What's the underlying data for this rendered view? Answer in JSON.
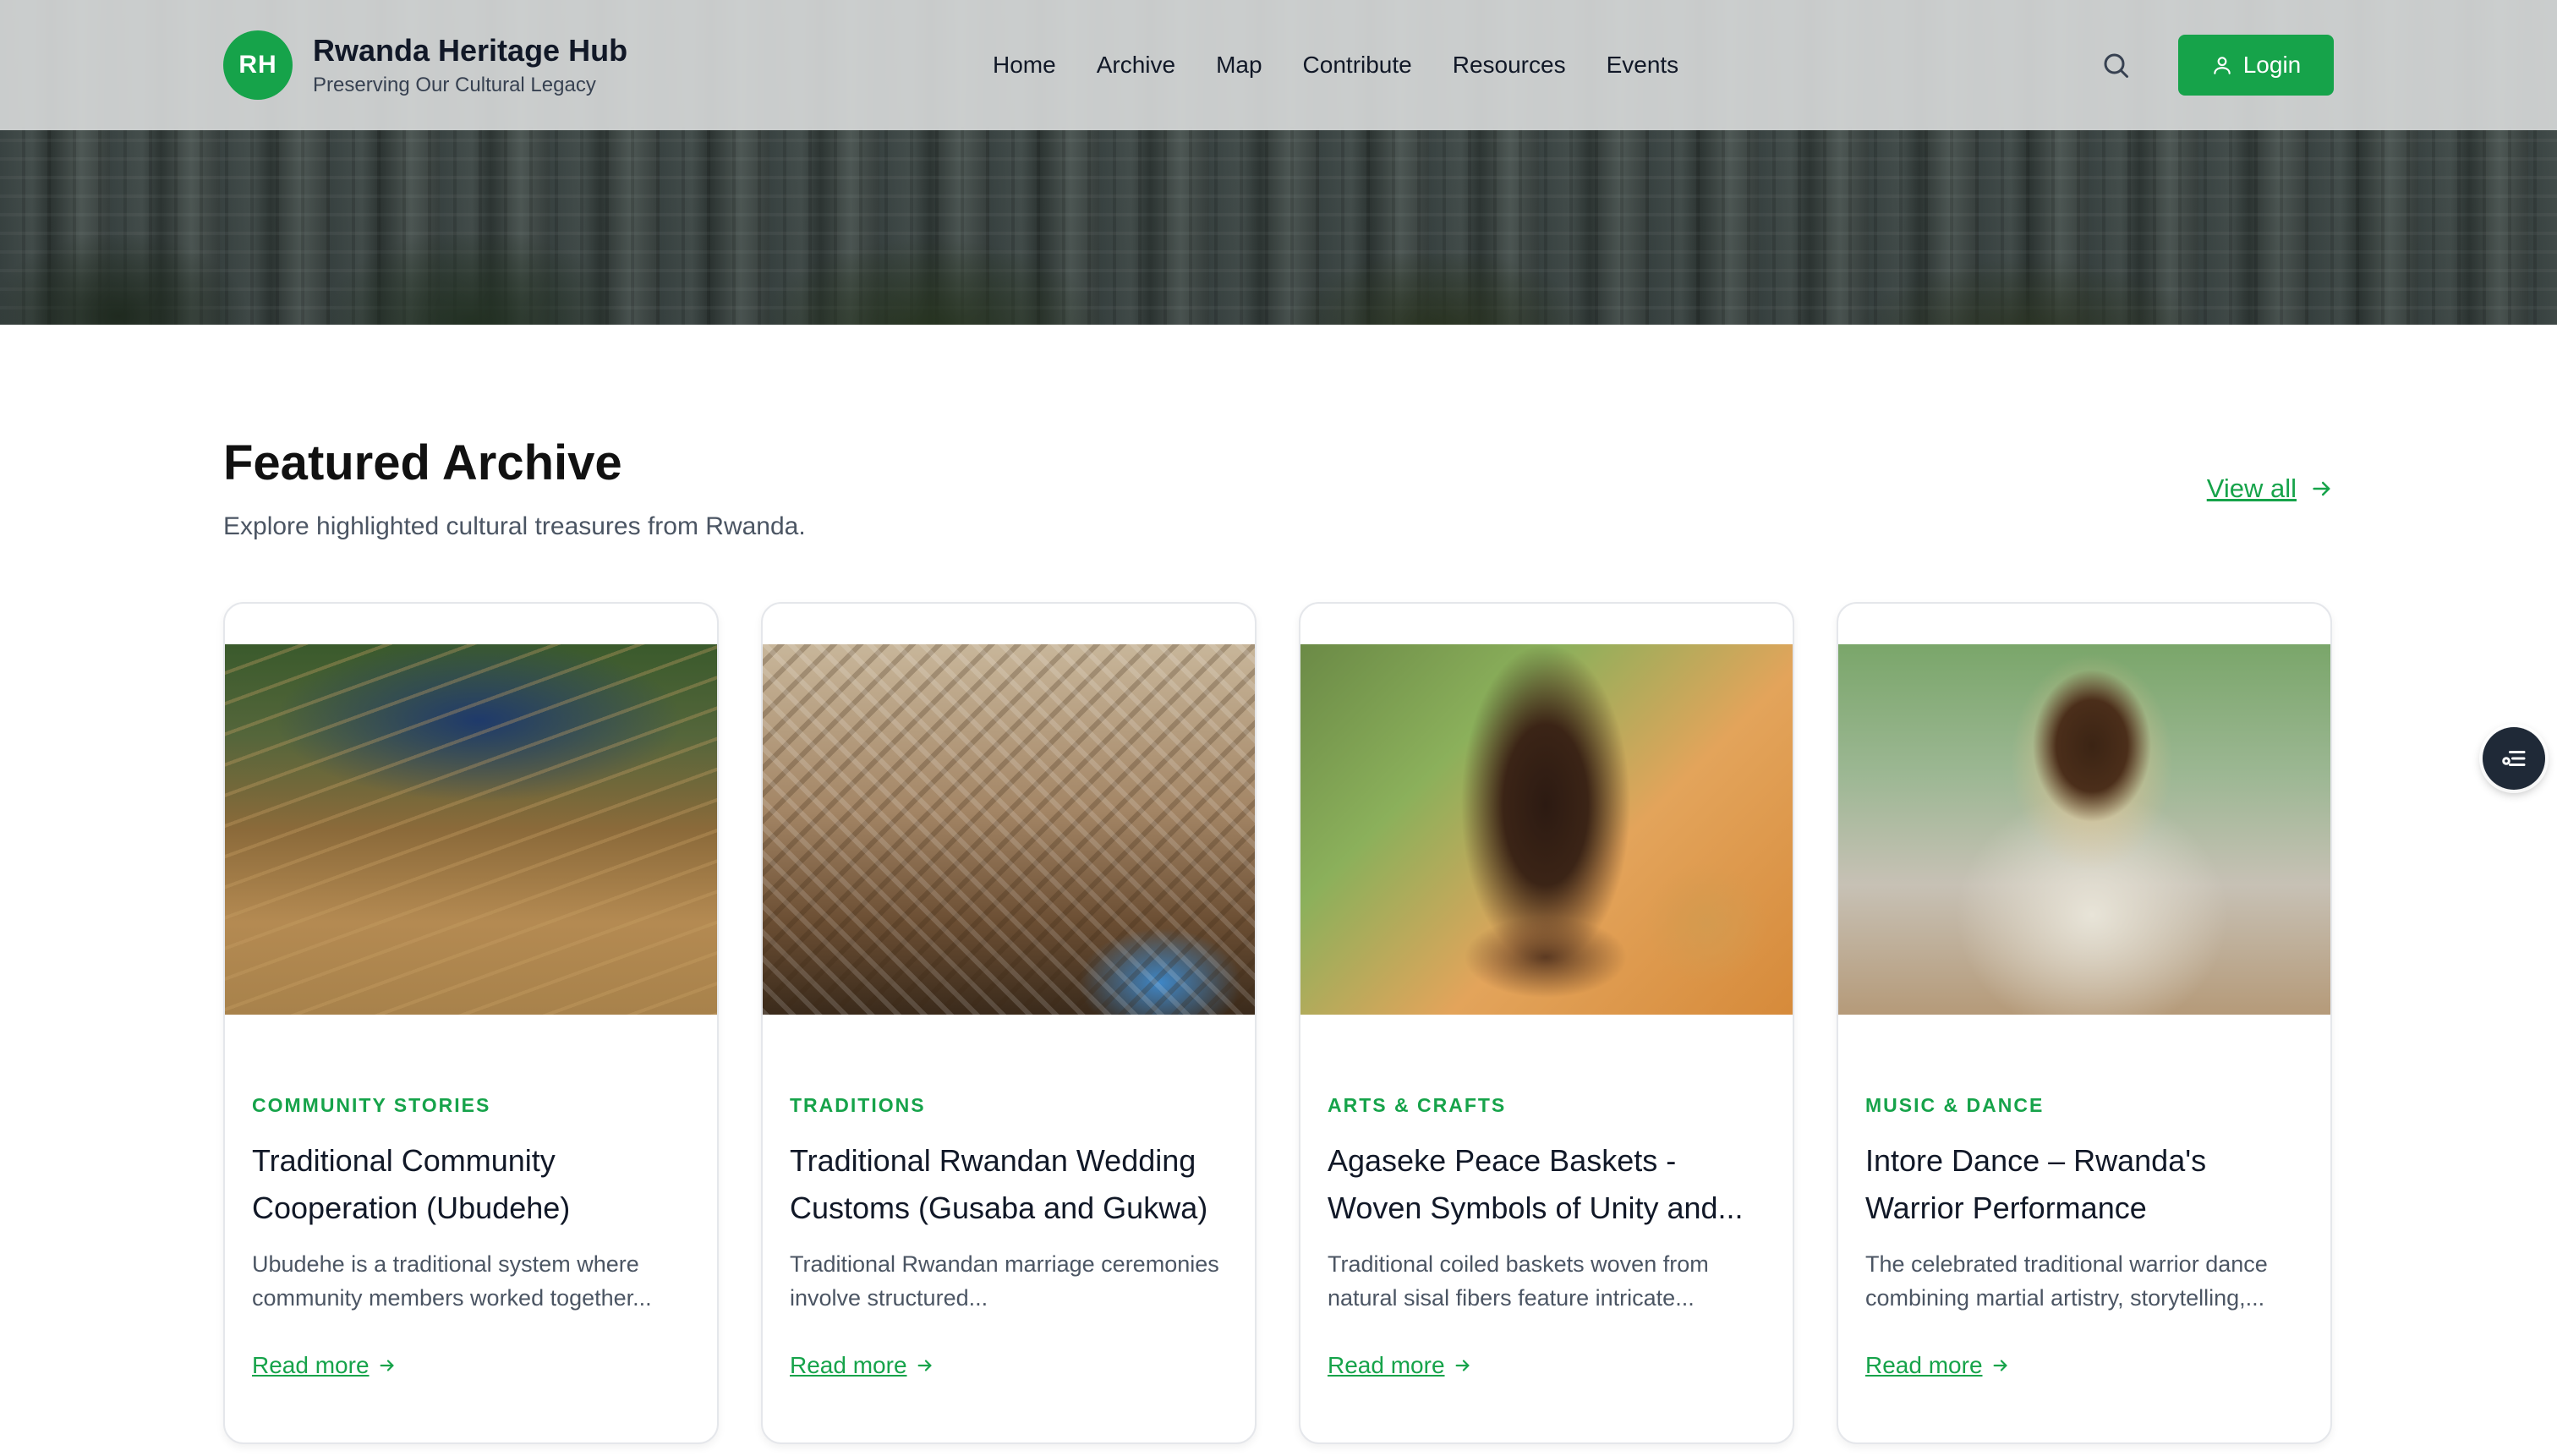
{
  "header": {
    "logo_initials": "RH",
    "site_title": "Rwanda Heritage Hub",
    "site_subtitle": "Preserving Our Cultural Legacy",
    "nav": [
      "Home",
      "Archive",
      "Map",
      "Contribute",
      "Resources",
      "Events"
    ],
    "login_label": "Login",
    "accent_color": "#16a34a"
  },
  "featured": {
    "title": "Featured Archive",
    "subtitle": "Explore highlighted cultural treasures from Rwanda.",
    "view_all_label": "View all",
    "cards": [
      {
        "category": "COMMUNITY STORIES",
        "title": "Traditional Community Cooperation (Ubudehe)",
        "description": "Ubudehe is a traditional system where community members worked together...",
        "read_more": "Read more"
      },
      {
        "category": "TRADITIONS",
        "title": "Traditional Rwandan Wedding Customs (Gusaba and Gukwa)",
        "description": "Traditional Rwandan marriage ceremonies involve structured...",
        "read_more": "Read more"
      },
      {
        "category": "ARTS & CRAFTS",
        "title": "Agaseke Peace Baskets - Woven Symbols of Unity and...",
        "description": "Traditional coiled baskets woven from natural sisal fibers feature intricate...",
        "read_more": "Read more"
      },
      {
        "category": "MUSIC & DANCE",
        "title": "Intore Dance – Rwanda's Warrior Performance",
        "description": "The celebrated traditional warrior dance combining martial artistry, storytelling,...",
        "read_more": "Read more"
      }
    ]
  },
  "icons": {
    "search": "search-icon",
    "user": "user-icon",
    "arrow": "arrow-right-icon",
    "floating": "list-settings-icon"
  }
}
